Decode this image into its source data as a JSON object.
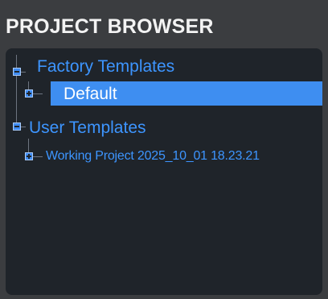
{
  "panel": {
    "title": "PROJECT BROWSER"
  },
  "tree": {
    "factory": {
      "label": "Factory Templates",
      "expander_icon": "minus-square-icon",
      "children": [
        {
          "label": "Default",
          "expander_icon": "plus-square-icon",
          "selected": true
        }
      ]
    },
    "user": {
      "label": "User Templates",
      "expander_icon": "minus-square-icon",
      "children": [
        {
          "label": "Working Project 2025_10_01 18.23.21",
          "expander_icon": "plus-square-icon",
          "selected": false
        }
      ]
    }
  },
  "colors": {
    "panel_background": "#3b3d40",
    "tree_background": "#1f242a",
    "accent": "#3e8ef1",
    "text_blue": "#3d95ff",
    "title_text": "#f3f3f3"
  }
}
